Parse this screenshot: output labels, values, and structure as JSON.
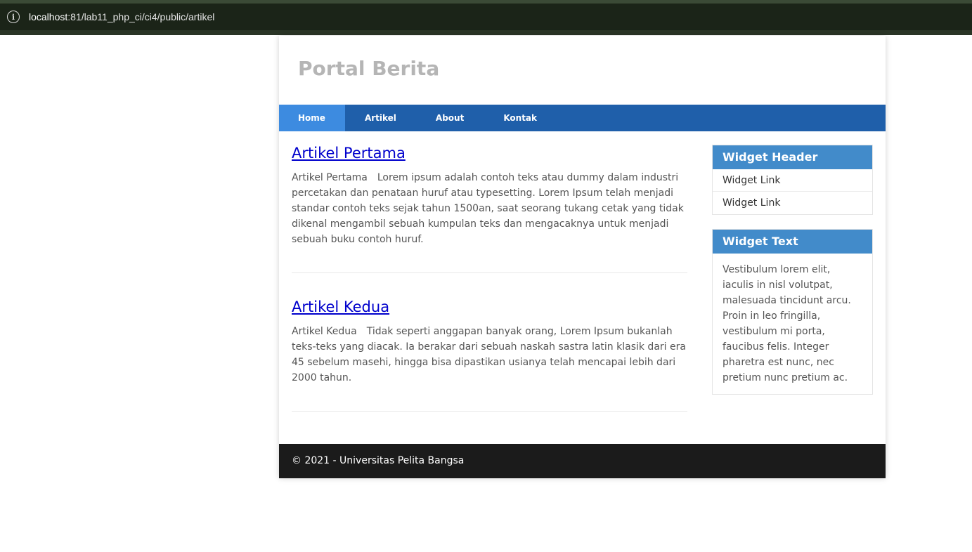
{
  "browser": {
    "url_host": "localhost",
    "url_rest": ":81/lab11_php_ci/ci4/public/artikel"
  },
  "header": {
    "title": "Portal Berita"
  },
  "nav": {
    "items": [
      {
        "label": "Home",
        "active": true
      },
      {
        "label": "Artikel"
      },
      {
        "label": "About"
      },
      {
        "label": "Kontak"
      }
    ]
  },
  "articles": [
    {
      "title": "Artikel Pertama",
      "image_alt": "Artikel Pertama",
      "body": "Lorem ipsum adalah contoh teks atau dummy dalam industri percetakan dan penataan huruf atau typesetting. Lorem Ipsum telah menjadi standar contoh teks sejak tahun 1500an, saat seorang tukang cetak yang tidak dikenal mengambil sebuah kumpulan teks dan mengacaknya untuk menjadi sebuah buku contoh huruf."
    },
    {
      "title": "Artikel Kedua",
      "image_alt": "Artikel Kedua",
      "body": "Tidak seperti anggapan banyak orang, Lorem Ipsum bukanlah teks-teks yang diacak. Ia berakar dari sebuah naskah sastra latin klasik dari era 45 sebelum masehi, hingga bisa dipastikan usianya telah mencapai lebih dari 2000 tahun."
    }
  ],
  "sidebar": {
    "widget_header": {
      "title": "Widget Header",
      "links": [
        "Widget Link",
        "Widget Link"
      ]
    },
    "widget_text": {
      "title": "Widget Text",
      "text": "Vestibulum lorem elit, iaculis in nisl volutpat, malesuada tincidunt arcu. Proin in leo fringilla, vestibulum mi porta, faucibus felis. Integer pharetra est nunc, nec pretium nunc pretium ac."
    }
  },
  "footer": {
    "text": "© 2021 - Universitas Pelita Bangsa"
  },
  "colors": {
    "nav_bg": "#1f5faa",
    "nav_active": "#3d8be0",
    "widget_title_bg": "#428bca",
    "footer_bg": "#1b1b1b"
  }
}
